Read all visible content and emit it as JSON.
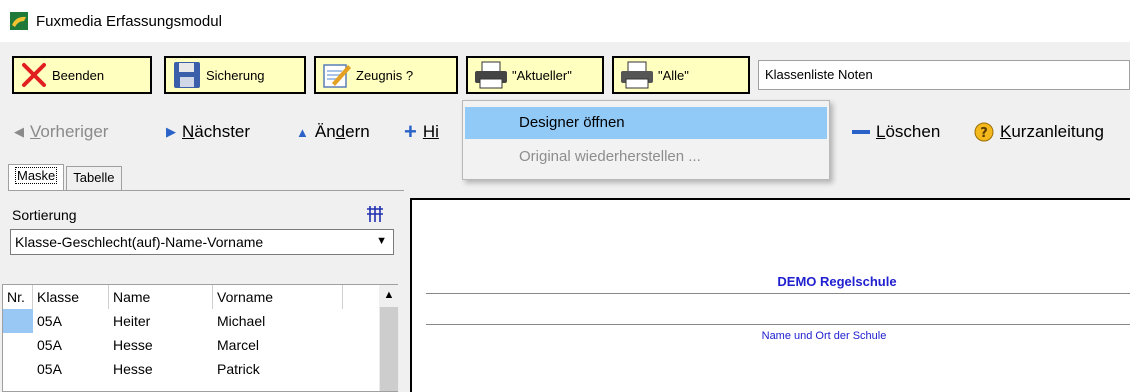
{
  "window": {
    "title": "Fuxmedia Erfassungsmodul"
  },
  "toolbar": {
    "beenden": "Beenden",
    "sicherung": "Sicherung",
    "zeugnis": "Zeugnis ?",
    "aktueller": "\"Aktueller\"",
    "alle": "\"Alle\"",
    "report_select": "Klassenliste Noten"
  },
  "nav": {
    "prev_rest": "orheriger",
    "prev_u": "V",
    "next_rest": "ächster",
    "next_u": "N",
    "edit_pre": "Än",
    "edit_u": "d",
    "edit_rest": "ern",
    "insert_u": "Hi",
    "delete_u": "L",
    "delete_rest": "öschen",
    "help_u": "K",
    "help_rest": "urzanleitung"
  },
  "dropdown": {
    "items": [
      {
        "label": "Designer öffnen"
      },
      {
        "label": "Original wiederherstellen ..."
      }
    ]
  },
  "tabs": {
    "maske": "Maske",
    "tabelle": "Tabelle"
  },
  "sort": {
    "label": "Sortierung",
    "value": "Klasse-Geschlecht(auf)-Name-Vorname"
  },
  "table": {
    "headers": [
      "Nr.",
      "Klasse",
      "Name",
      "Vorname"
    ],
    "rows": [
      {
        "nr": "",
        "klasse": "05A",
        "name": "Heiter",
        "vorname": "Michael"
      },
      {
        "nr": "",
        "klasse": "05A",
        "name": "Hesse",
        "vorname": "Marcel"
      },
      {
        "nr": "",
        "klasse": "05A",
        "name": "Hesse",
        "vorname": "Patrick"
      }
    ]
  },
  "preview": {
    "school_name": "DEMO Regelschule",
    "school_sub": "Name und Ort der Schule"
  },
  "colors": {
    "button_bg": "#ffffc0",
    "highlight": "#91c9f7",
    "school_text": "#2020d0"
  }
}
